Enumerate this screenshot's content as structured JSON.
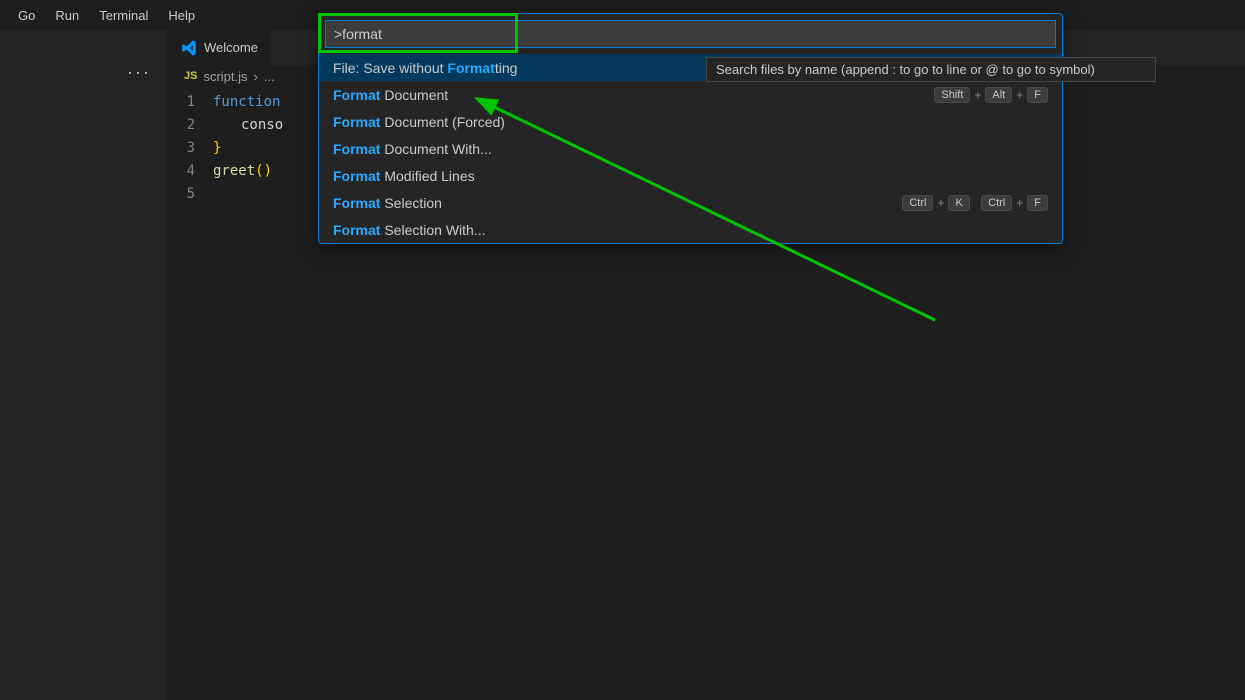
{
  "menubar": {
    "items": [
      "Go",
      "Run",
      "Terminal",
      "Help"
    ]
  },
  "sidebar": {
    "more": "···"
  },
  "tabs": {
    "welcome": "Welcome"
  },
  "breadcrumbs": {
    "file": "script.js",
    "sep": "›",
    "more": "..."
  },
  "code": {
    "lines": [
      "1",
      "2",
      "3",
      "4",
      "5"
    ],
    "l1_kw": "function",
    "l1_rest": "",
    "l2": "conso",
    "l3": "}",
    "l4_id": "greet",
    "l4_paren": "()"
  },
  "palette": {
    "input_value": ">format",
    "tooltip": "Search files by name (append : to go to line or @ to go to symbol)",
    "items": [
      {
        "pre": "File: Save without ",
        "hl": "Format",
        "post": "ting",
        "kb": null,
        "selected": true
      },
      {
        "pre": "",
        "hl": "Format",
        "post": " Document",
        "kb": [
          "Shift",
          "+",
          "Alt",
          "+",
          "F"
        ],
        "selected": false
      },
      {
        "pre": "",
        "hl": "Format",
        "post": " Document (Forced)",
        "kb": null,
        "selected": false
      },
      {
        "pre": "",
        "hl": "Format",
        "post": " Document With...",
        "kb": null,
        "selected": false
      },
      {
        "pre": "",
        "hl": "Format",
        "post": " Modified Lines",
        "kb": null,
        "selected": false
      },
      {
        "pre": "",
        "hl": "Format",
        "post": " Selection",
        "kb": [
          "Ctrl",
          "+",
          "K",
          "",
          "Ctrl",
          "+",
          "F"
        ],
        "selected": false
      },
      {
        "pre": "",
        "hl": "Format",
        "post": " Selection With...",
        "kb": null,
        "selected": false
      }
    ]
  }
}
